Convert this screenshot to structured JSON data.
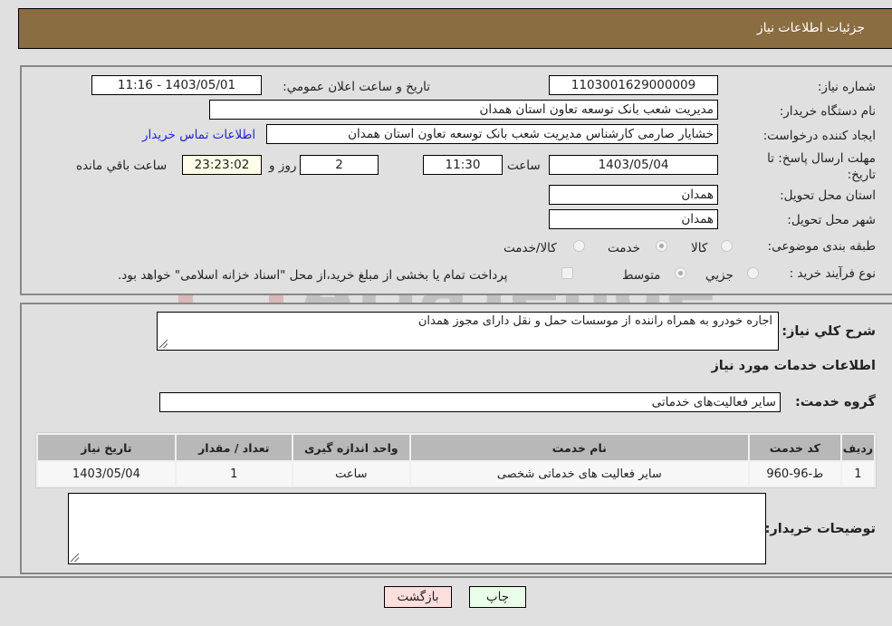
{
  "header": {
    "title": "جزئیات اطلاعات نیاز"
  },
  "form": {
    "need_number": {
      "label": "شماره نیاز:",
      "value": "1103001629000009"
    },
    "announce_datetime": {
      "label": "تاریخ و ساعت اعلان عمومي:",
      "value": "1403/05/01 - 11:16"
    },
    "buyer_org": {
      "label": "نام دستگاه خریدار:",
      "value": "مدیریت شعب بانک توسعه تعاون استان همدان"
    },
    "requester": {
      "label": "ایجاد کننده درخواست:",
      "value": "خشایار صارمی کارشناس مدیریت شعب بانک توسعه تعاون استان همدان"
    },
    "buyer_contact_link": "اطلاعات تماس خریدار",
    "deadline": {
      "label": "مهلت ارسال پاسخ: تا تاریخ:",
      "date": "1403/05/04",
      "time_label": "ساعت",
      "time": "11:30",
      "days": "2",
      "days_label": "روز و",
      "remaining": "23:23:02",
      "remaining_label": "ساعت باقي مانده"
    },
    "delivery_province": {
      "label": "استان محل تحویل:",
      "value": "همدان"
    },
    "delivery_city": {
      "label": "شهر محل تحویل:",
      "value": "همدان"
    },
    "category": {
      "label": "طبقه بندی موضوعی:",
      "options": [
        "کالا",
        "خدمت",
        "کالا/خدمت"
      ],
      "selected": "خدمت"
    },
    "purchase_type": {
      "label": "نوع فرآیند خرید :",
      "options": [
        "جزیي",
        "متوسط"
      ],
      "selected": "متوسط",
      "treasury_note": "پرداخت تمام یا بخشی از مبلغ خرید،از محل \"اسناد خزانه اسلامی\" خواهد بود."
    }
  },
  "details": {
    "description_label": "شرح کلي نیاز:",
    "description": "اجاره خودرو به همراه راننده از موسسات حمل و نقل دارای مجوز همدان",
    "services_heading": "اطلاعات خدمات مورد نیاز",
    "service_group_label": "گروه خدمت:",
    "service_group": "سایر فعالیت‌های خدماتی",
    "table": {
      "headers": [
        "ردیف",
        "کد خدمت",
        "نام خدمت",
        "واحد اندازه گیری",
        "تعداد / مقدار",
        "تاریخ نیاز"
      ],
      "rows": [
        [
          "1",
          "ط-96-960",
          "سایر فعالیت های خدماتی شخصی",
          "ساعت",
          "1",
          "1403/05/04"
        ]
      ]
    },
    "buyer_notes_label": "توضیحات خریدار:",
    "buyer_notes": ""
  },
  "buttons": {
    "print": "چاپ",
    "back": "بازگشت"
  },
  "watermark": {
    "text": "AriaTender.neT"
  }
}
